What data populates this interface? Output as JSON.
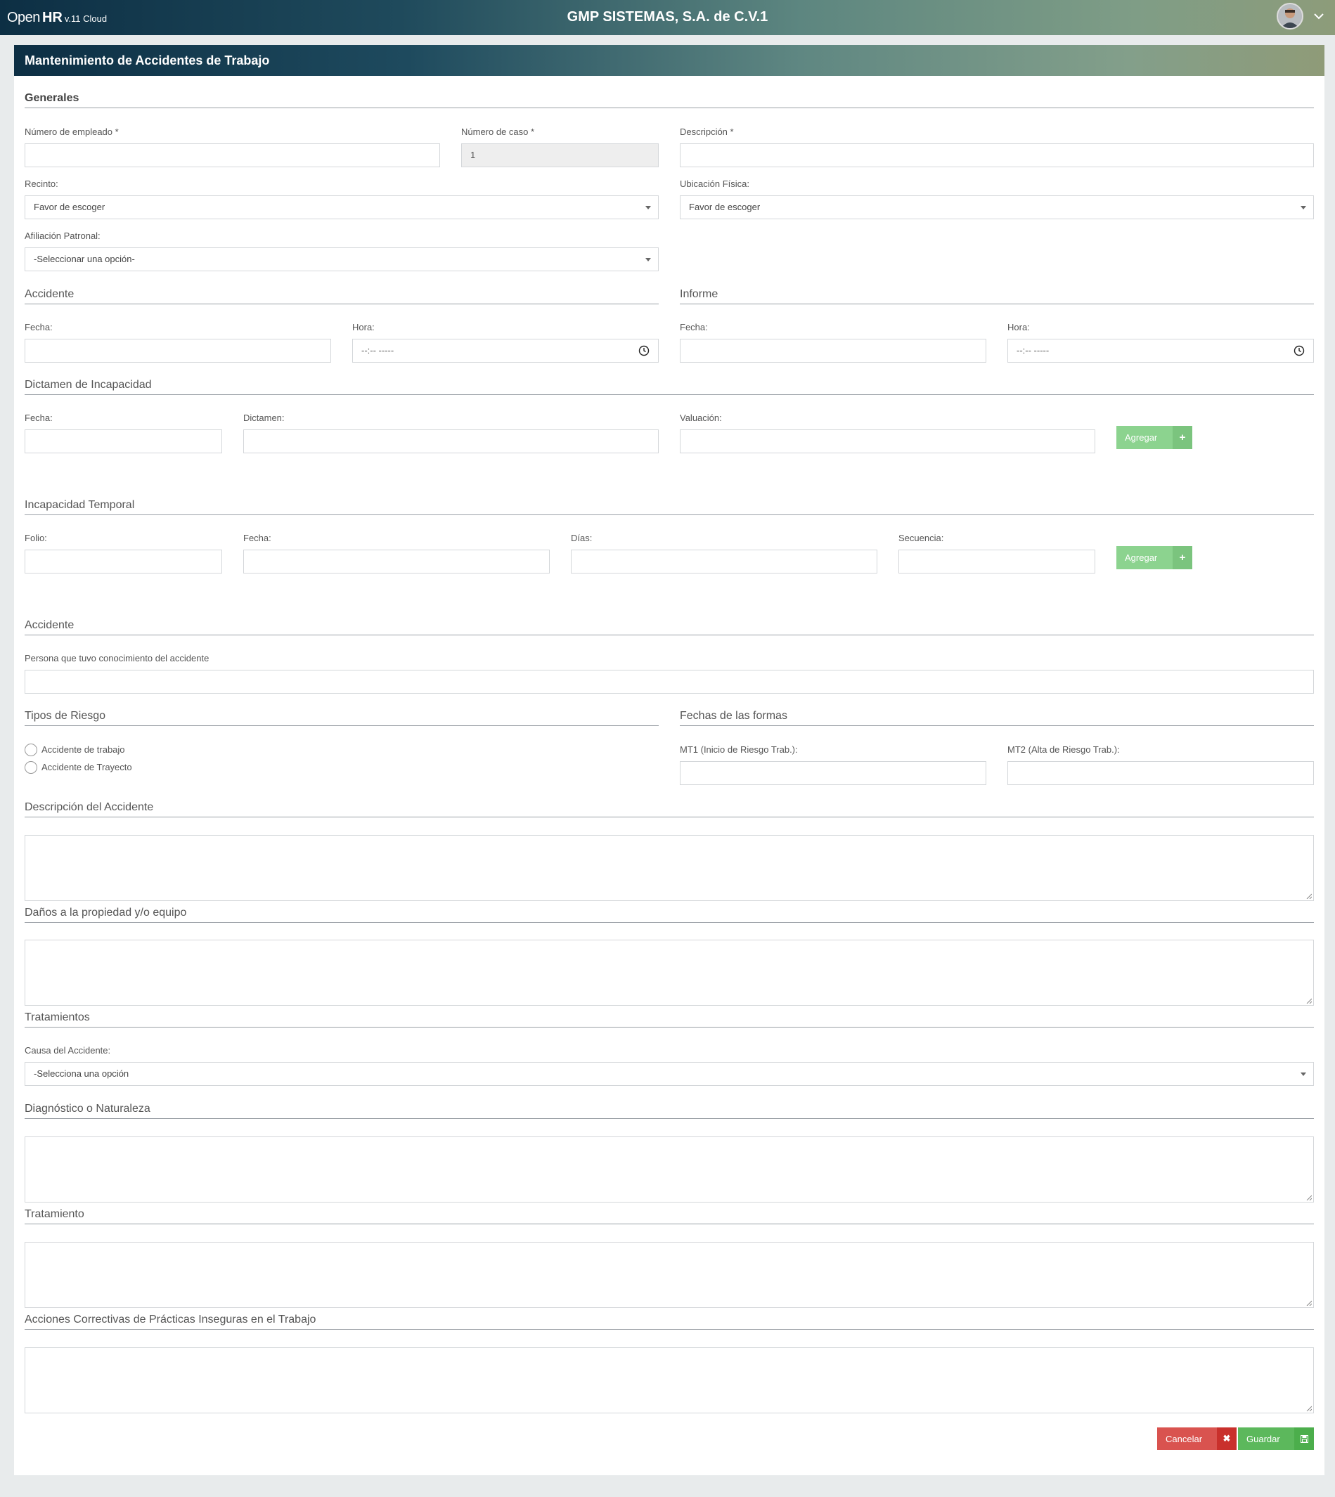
{
  "app": {
    "logo_open": "Open",
    "logo_hr": "HR",
    "logo_version": "v.11 Cloud",
    "company": "GMP SISTEMAS, S.A. de C.V.1"
  },
  "page_title": "Mantenimiento de Accidentes de Trabajo",
  "generales": {
    "title": "Generales",
    "numero_empleado_label": "Número de empleado *",
    "numero_caso_label": "Número de caso *",
    "numero_caso_value": "1",
    "descripcion_label": "Descripción *",
    "recinto_label": "Recinto:",
    "recinto_value": "Favor de escoger",
    "ubicacion_label": "Ubicación Física:",
    "ubicacion_value": "Favor de escoger",
    "afiliacion_label": "Afiliación Patronal:",
    "afiliacion_value": "-Seleccionar una opción-"
  },
  "accidente": {
    "title": "Accidente",
    "fecha_label": "Fecha:",
    "hora_label": "Hora:",
    "hora_placeholder": "--:-- -----"
  },
  "informe": {
    "title": "Informe",
    "fecha_label": "Fecha:",
    "hora_label": "Hora:",
    "hora_placeholder": "--:-- -----"
  },
  "dictamen": {
    "title": "Dictamen de Incapacidad",
    "fecha_label": "Fecha:",
    "dictamen_label": "Dictamen:",
    "valuacion_label": "Valuación:",
    "add_label": "Agregar"
  },
  "incapacidad": {
    "title": "Incapacidad Temporal",
    "folio_label": "Folio:",
    "fecha_label": "Fecha:",
    "dias_label": "Días:",
    "secuencia_label": "Secuencia:",
    "add_label": "Agregar"
  },
  "accidente2": {
    "title": "Accidente",
    "persona_label": "Persona que tuvo conocimiento del accidente"
  },
  "riesgo": {
    "title": "Tipos de Riesgo",
    "options": [
      "Accidente de trabajo",
      "Accidente de Trayecto"
    ]
  },
  "formas": {
    "title": "Fechas de las formas",
    "mt1_label": "MT1 (Inicio de Riesgo Trab.):",
    "mt2_label": "MT2 (Alta de Riesgo Trab.):"
  },
  "descripcion_accidente": {
    "title": "Descripción del Accidente"
  },
  "danos": {
    "title": "Daños a la propiedad y/o equipo"
  },
  "tratamientos": {
    "title": "Tratamientos",
    "causa_label": "Causa del Accidente:",
    "causa_value": "-Selecciona una opción"
  },
  "diagnostico": {
    "title": "Diagnóstico o Naturaleza"
  },
  "tratamiento": {
    "title": "Tratamiento"
  },
  "acciones": {
    "title": "Acciones Correctivas de Prácticas Inseguras en el Trabajo"
  },
  "actions": {
    "cancel_label": "Cancelar",
    "save_label": "Guardar"
  },
  "icons": {
    "add": "plus-icon",
    "cancel": "close-icon",
    "save": "floppy-disk-icon",
    "time": "clock-icon",
    "user_menu": "chevron-down-icon"
  },
  "colors": {
    "header_start": "#0d2f44",
    "header_end": "#8f9b78",
    "add_button": "#8cd38f",
    "cancel_button": "#d9534f",
    "save_button": "#5cb85c"
  }
}
